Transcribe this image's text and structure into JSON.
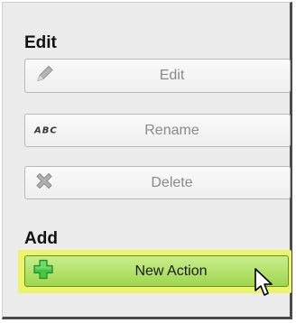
{
  "edit_section": {
    "title": "Edit",
    "buttons": [
      {
        "label": "Edit",
        "icon": "pencil-icon"
      },
      {
        "label": "Rename",
        "icon": "abc-icon",
        "icon_text": "ABC"
      },
      {
        "label": "Delete",
        "icon": "delete-x-icon"
      }
    ]
  },
  "add_section": {
    "title": "Add",
    "buttons": [
      {
        "label": "New Action",
        "icon": "plus-icon"
      }
    ]
  },
  "colors": {
    "highlight": "#ecf46a",
    "primary_button": "#a6da58",
    "plus_icon": "#3cc43c"
  }
}
